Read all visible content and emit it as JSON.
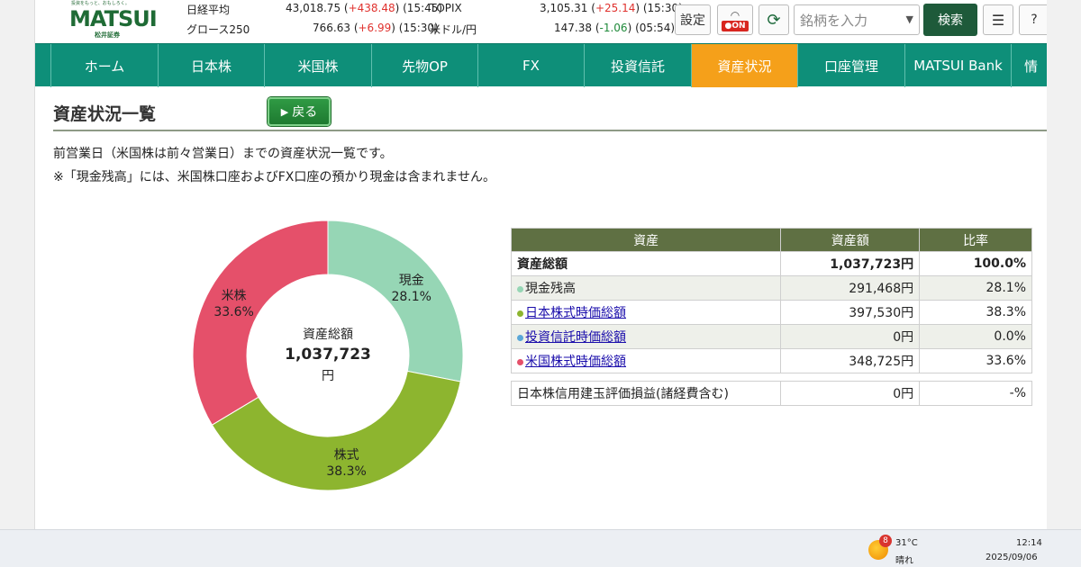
{
  "header": {
    "logo_tagline": "投資をもっと、おもしろく。",
    "logo_brand": "MATSUI",
    "logo_sub": "松井証券",
    "tickers": [
      {
        "name": "日経平均",
        "value": "43,018.75",
        "change": "+438.48",
        "time": "(15:45)",
        "dir": "up"
      },
      {
        "name": "TOPIX",
        "value": "3,105.31",
        "change": "+25.14",
        "time": "(15:30)",
        "dir": "up"
      },
      {
        "name": "グロース250",
        "value": "766.63",
        "change": "+6.99",
        "time": "(15:30)",
        "dir": "up"
      },
      {
        "name": "米ドル/円",
        "value": "147.38",
        "change": "-1.06",
        "time": "(05:54)",
        "dir": "down"
      }
    ],
    "settings_label": "設定",
    "on_label": "ON",
    "search_placeholder": "銘柄を入力",
    "search_button": "検索",
    "help_label": "?"
  },
  "nav": {
    "items": [
      {
        "label": "ホーム"
      },
      {
        "label": "日本株"
      },
      {
        "label": "米国株"
      },
      {
        "label": "先物OP"
      },
      {
        "label": "FX"
      },
      {
        "label": "投資信託"
      },
      {
        "label": "資産状況"
      },
      {
        "label": "口座管理"
      },
      {
        "label": "MATSUI Bank"
      },
      {
        "label": "情"
      }
    ]
  },
  "page": {
    "title": "資産状況一覧",
    "back_label": "戻る",
    "desc1": "前営業日（米国株は前々営業日）までの資産状況一覧です。",
    "desc2": "※「現金残高」には、米国株口座およびFX口座の預かり現金は含まれません。"
  },
  "chart_data": {
    "type": "pie",
    "center_label": "資産総額",
    "center_value": "1,037,723",
    "center_unit": "円",
    "slices": [
      {
        "label": "現金",
        "value": 28.1,
        "display": "28.1%",
        "color": "#96d6b5"
      },
      {
        "label": "株式",
        "value": 38.3,
        "display": "38.3%",
        "color": "#8db52f"
      },
      {
        "label": "米株",
        "value": 33.6,
        "display": "33.6%",
        "color": "#e5506a"
      }
    ]
  },
  "table": {
    "headers": [
      "資産",
      "資産額",
      "比率"
    ],
    "total": {
      "label": "資産総額",
      "amount": "1,037,723円",
      "ratio": "100.0%"
    },
    "rows": [
      {
        "label": "現金残高",
        "amount": "291,468円",
        "ratio": "28.1%",
        "color": "#96d6b5",
        "link": false
      },
      {
        "label": "日本株式時価総額",
        "amount": "397,530円",
        "ratio": "38.3%",
        "color": "#8db52f",
        "link": true
      },
      {
        "label": "投資信託時価総額",
        "amount": "0円",
        "ratio": "0.0%",
        "color": "#5aa7d8",
        "link": true
      },
      {
        "label": "米国株式時価総額",
        "amount": "348,725円",
        "ratio": "33.6%",
        "color": "#e5506a",
        "link": true
      }
    ],
    "margin_row": {
      "label": "日本株信用建玉評価損益(諸経費含む)",
      "amount": "0円",
      "ratio": "-%"
    }
  },
  "taskbar": {
    "badge": "8",
    "temp": "31°C",
    "weather": "晴れ",
    "time": "12:14",
    "date": "2025/09/06"
  }
}
